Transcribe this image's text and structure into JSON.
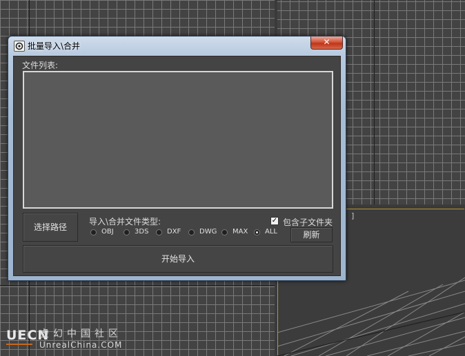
{
  "window": {
    "title": "批量导入\\合并",
    "close_label": "✕",
    "file_list_label": "文件列表:",
    "select_path_button": "选择路径",
    "file_type_label": "导入\\合并文件类型:",
    "include_subfolders_label": "包含子文件夹",
    "include_subfolders_checked": true,
    "refresh_button": "刷新",
    "start_import_button": "开始导入",
    "file_types": [
      {
        "label": "OBJ",
        "selected": false
      },
      {
        "label": "3DS",
        "selected": false
      },
      {
        "label": "DXF",
        "selected": false
      },
      {
        "label": "DWG",
        "selected": false
      },
      {
        "label": "MAX",
        "selected": false
      },
      {
        "label": "ALL",
        "selected": true
      }
    ]
  },
  "viewport": {
    "label_fragment": "]"
  },
  "watermark": {
    "logo": "UECN",
    "title": "虚幻中国社区",
    "site": "UnrealChina.COM"
  },
  "colors": {
    "accent_viewport_border": "#b8962e",
    "close_button": "#c03417",
    "list_background": "#5a5a5a"
  },
  "icons": {
    "app": "app-icon",
    "close": "close-icon",
    "checkbox": "checkmark-icon"
  }
}
